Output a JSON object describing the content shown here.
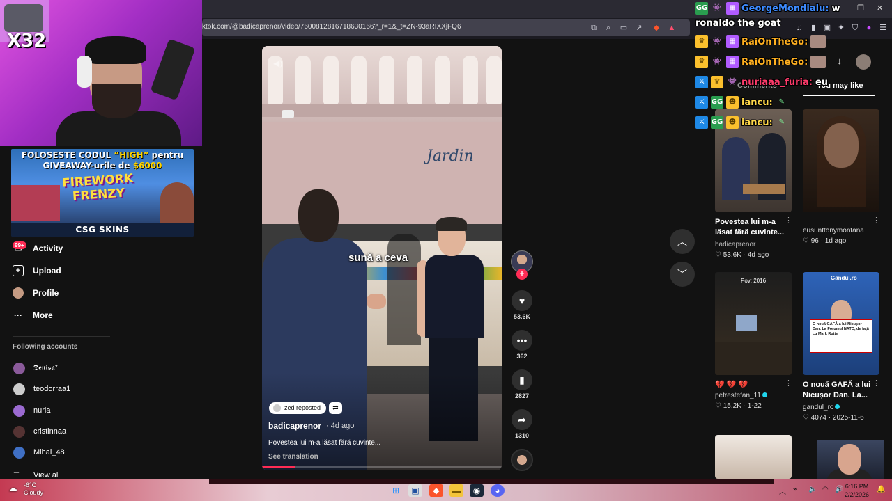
{
  "browser": {
    "url": "ktok.com/@badicaprenor/video/7600812816718630166?_r=1&_t=ZN-93aRIXXjFQ6",
    "window_controls": [
      "–",
      "❐",
      "✕"
    ]
  },
  "stream": {
    "multiplier": "X32",
    "promo": {
      "line1_a": "FOLOSESTE CODUL ",
      "line1_code": "“HIGH”",
      "line1_b": " pentru",
      "line2_a": "GIVEAWAY-urile de ",
      "line2_amount": "$6000",
      "game_title_1": "FIREWORK",
      "game_title_2": "FRENZY",
      "brand": "CSG SKINS"
    }
  },
  "sidebar": {
    "badge": "99+",
    "items": [
      {
        "label": "Activity",
        "icon": "inbox-icon"
      },
      {
        "label": "Upload",
        "icon": "plus-square-icon"
      },
      {
        "label": "Profile",
        "icon": "avatar-icon"
      },
      {
        "label": "More",
        "icon": "ellipsis-icon"
      }
    ],
    "following_title": "Following accounts",
    "accounts": [
      {
        "name": "𝕯𝖊𝖓𝖎𝖘𝖆⁷",
        "color": "#8a5a9a"
      },
      {
        "name": "teodorraa1",
        "color": "#ccc"
      },
      {
        "name": "nuria",
        "color": "#9b6ad1"
      },
      {
        "name": "cristinnaa",
        "color": "#553333"
      },
      {
        "name": "Mihai_48",
        "color": "#3f6fc4"
      }
    ],
    "view_all": "View all"
  },
  "video": {
    "sign_text": "Jardin",
    "subtitle": "sună a ceva",
    "reposted_by": "zed reposted",
    "author": "badicaprenor",
    "age": "· 4d ago",
    "description": "Povestea lui m-a lăsat fără cuvinte...",
    "see_translation": "See translation",
    "progress": 0.14
  },
  "actions": {
    "likes": "53.6K",
    "comments": "362",
    "saves": "2827",
    "shares": "1310"
  },
  "right_panel": {
    "tabs": [
      "Comments",
      "You may like"
    ],
    "active_tab": "You may like",
    "cards": [
      {
        "title": "Povestea lui m-a lăsat fără cuvinte...",
        "user": "badicaprenor",
        "likes": "53.6K",
        "date": "4d ago"
      },
      {
        "title": "",
        "user": "eusunttonymontana",
        "likes": "96",
        "date": "1d ago"
      },
      {
        "title": "",
        "thumb_text": "Pov: 2016",
        "user": "petrestefan_11",
        "likes": "15.2K",
        "date": "1-22",
        "emoji": "💔 💔 💔"
      },
      {
        "title": "O nouă GAFĂ a lui Nicușor Dan. La...",
        "thumb_text": "O nouă GAFĂ a lui Nicușor Dan. La Forumul NATO, de față cu Mark Rutte",
        "thumb_brand": "Gândul.ro",
        "user": "gandul_ro",
        "likes": "4074",
        "date": "2025-11-6"
      }
    ]
  },
  "chat": [
    {
      "user": "GeorgeMondialu:",
      "msg": "w",
      "color": "#3d8bff"
    },
    {
      "user": "",
      "msg": "ronaldo the goat",
      "color": "#ffffff"
    },
    {
      "user": "RaiOnTheGo:",
      "msg": "",
      "color": "#ffb020"
    },
    {
      "user": "RaiOnTheGo:",
      "msg": "",
      "color": "#ffb020"
    },
    {
      "user": "nuriaaa_furia:",
      "msg": "eu",
      "color": "#ff3b6b"
    },
    {
      "user": "iancu:",
      "msg": "",
      "color": "#ffd84a"
    },
    {
      "user": "iancu:",
      "msg": "",
      "color": "#ffd84a"
    }
  ],
  "taskbar": {
    "temp": "-6°C",
    "weather": "Cloudy",
    "time": "6:16 PM",
    "date": "2/2/2026"
  }
}
